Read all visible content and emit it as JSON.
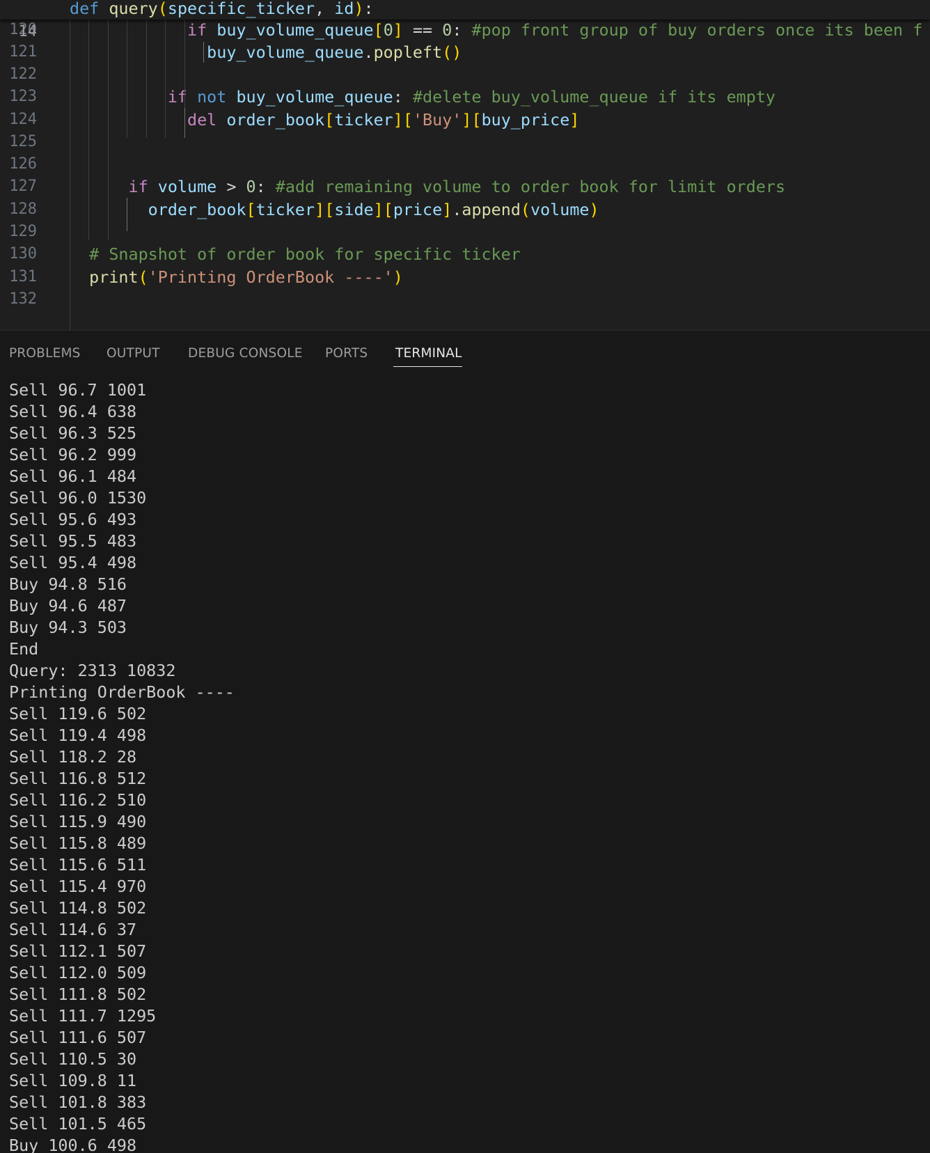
{
  "editor": {
    "sticky": {
      "line_number": "14",
      "parts": [
        {
          "t": "def",
          "c": "t-kw"
        },
        {
          "t": " ",
          "c": ""
        },
        {
          "t": "query",
          "c": "t-fn"
        },
        {
          "t": "(",
          "c": "t-b1"
        },
        {
          "t": "specific_ticker",
          "c": "t-par"
        },
        {
          "t": ", ",
          "c": "t-op"
        },
        {
          "t": "id",
          "c": "t-par"
        },
        {
          "t": ")",
          "c": "t-b1"
        },
        {
          "t": ":",
          "c": "t-op"
        }
      ]
    },
    "lines": [
      {
        "number": "120",
        "parts": [
          {
            "t": "            ",
            "c": ""
          },
          {
            "t": "if",
            "c": "t-ctl"
          },
          {
            "t": " ",
            "c": ""
          },
          {
            "t": "buy_volume_queue",
            "c": "t-var"
          },
          {
            "t": "[",
            "c": "t-b1"
          },
          {
            "t": "0",
            "c": "t-num"
          },
          {
            "t": "]",
            "c": "t-b1"
          },
          {
            "t": " == ",
            "c": "t-op"
          },
          {
            "t": "0",
            "c": "t-num"
          },
          {
            "t": ": ",
            "c": "t-op"
          },
          {
            "t": "#pop front group of buy orders once its been f",
            "c": "t-cm"
          }
        ]
      },
      {
        "number": "121",
        "parts": [
          {
            "t": "              ",
            "c": ""
          },
          {
            "t": "buy_volume_queue",
            "c": "t-var"
          },
          {
            "t": ".",
            "c": "t-op"
          },
          {
            "t": "popleft",
            "c": "t-fn"
          },
          {
            "t": "()",
            "c": "t-b1"
          }
        ]
      },
      {
        "number": "122",
        "parts": []
      },
      {
        "number": "123",
        "parts": [
          {
            "t": "          ",
            "c": ""
          },
          {
            "t": "if",
            "c": "t-ctl"
          },
          {
            "t": " ",
            "c": ""
          },
          {
            "t": "not",
            "c": "t-kw"
          },
          {
            "t": " ",
            "c": ""
          },
          {
            "t": "buy_volume_queue",
            "c": "t-var"
          },
          {
            "t": ": ",
            "c": "t-op"
          },
          {
            "t": "#delete buy_volume_queue if its empty",
            "c": "t-cm"
          }
        ]
      },
      {
        "number": "124",
        "parts": [
          {
            "t": "            ",
            "c": ""
          },
          {
            "t": "del",
            "c": "t-ctl"
          },
          {
            "t": " ",
            "c": ""
          },
          {
            "t": "order_book",
            "c": "t-var"
          },
          {
            "t": "[",
            "c": "t-b1"
          },
          {
            "t": "ticker",
            "c": "t-var"
          },
          {
            "t": "]",
            "c": "t-b1"
          },
          {
            "t": "[",
            "c": "t-b1"
          },
          {
            "t": "'Buy'",
            "c": "t-str"
          },
          {
            "t": "]",
            "c": "t-b1"
          },
          {
            "t": "[",
            "c": "t-b1"
          },
          {
            "t": "buy_price",
            "c": "t-var"
          },
          {
            "t": "]",
            "c": "t-b1"
          }
        ]
      },
      {
        "number": "125",
        "parts": []
      },
      {
        "number": "126",
        "parts": []
      },
      {
        "number": "127",
        "parts": [
          {
            "t": "      ",
            "c": ""
          },
          {
            "t": "if",
            "c": "t-ctl"
          },
          {
            "t": " ",
            "c": ""
          },
          {
            "t": "volume",
            "c": "t-var"
          },
          {
            "t": " > ",
            "c": "t-op"
          },
          {
            "t": "0",
            "c": "t-num"
          },
          {
            "t": ": ",
            "c": "t-op"
          },
          {
            "t": "#add remaining volume to order book for limit orders",
            "c": "t-cm"
          }
        ]
      },
      {
        "number": "128",
        "parts": [
          {
            "t": "        ",
            "c": ""
          },
          {
            "t": "order_book",
            "c": "t-var"
          },
          {
            "t": "[",
            "c": "t-b1"
          },
          {
            "t": "ticker",
            "c": "t-var"
          },
          {
            "t": "]",
            "c": "t-b1"
          },
          {
            "t": "[",
            "c": "t-b1"
          },
          {
            "t": "side",
            "c": "t-var"
          },
          {
            "t": "]",
            "c": "t-b1"
          },
          {
            "t": "[",
            "c": "t-b1"
          },
          {
            "t": "price",
            "c": "t-var"
          },
          {
            "t": "]",
            "c": "t-b1"
          },
          {
            "t": ".",
            "c": "t-op"
          },
          {
            "t": "append",
            "c": "t-fn"
          },
          {
            "t": "(",
            "c": "t-b1"
          },
          {
            "t": "volume",
            "c": "t-var"
          },
          {
            "t": ")",
            "c": "t-b1"
          }
        ]
      },
      {
        "number": "129",
        "parts": []
      },
      {
        "number": "130",
        "parts": [
          {
            "t": "  ",
            "c": ""
          },
          {
            "t": "# Snapshot of order book for specific ticker",
            "c": "t-cm"
          }
        ]
      },
      {
        "number": "131",
        "parts": [
          {
            "t": "  ",
            "c": ""
          },
          {
            "t": "print",
            "c": "t-fn"
          },
          {
            "t": "(",
            "c": "t-b1"
          },
          {
            "t": "'Printing OrderBook ----'",
            "c": "t-str"
          },
          {
            "t": ")",
            "c": "t-b1"
          }
        ]
      },
      {
        "number": "132",
        "parts": []
      }
    ]
  },
  "panel": {
    "tabs": [
      {
        "label": "PROBLEMS",
        "active": false
      },
      {
        "label": "OUTPUT",
        "active": false
      },
      {
        "label": "DEBUG CONSOLE",
        "active": false
      },
      {
        "label": "PORTS",
        "active": false
      },
      {
        "label": "TERMINAL",
        "active": true
      }
    ],
    "terminal_lines": [
      "Sell 96.7 1001",
      "Sell 96.4 638",
      "Sell 96.3 525",
      "Sell 96.2 999",
      "Sell 96.1 484",
      "Sell 96.0 1530",
      "Sell 95.6 493",
      "Sell 95.5 483",
      "Sell 95.4 498",
      "Buy 94.8 516",
      "Buy 94.6 487",
      "Buy 94.3 503",
      "End",
      "Query: 2313 10832",
      "Printing OrderBook ----",
      "Sell 119.6 502",
      "Sell 119.4 498",
      "Sell 118.2 28",
      "Sell 116.8 512",
      "Sell 116.2 510",
      "Sell 115.9 490",
      "Sell 115.8 489",
      "Sell 115.6 511",
      "Sell 115.4 970",
      "Sell 114.8 502",
      "Sell 114.6 37",
      "Sell 112.1 507",
      "Sell 112.0 509",
      "Sell 111.8 502",
      "Sell 111.7 1295",
      "Sell 111.6 507",
      "Sell 110.5 30",
      "Sell 109.8 11",
      "Sell 101.8 383",
      "Sell 101.5 465",
      "Buy 100.6 498"
    ]
  }
}
